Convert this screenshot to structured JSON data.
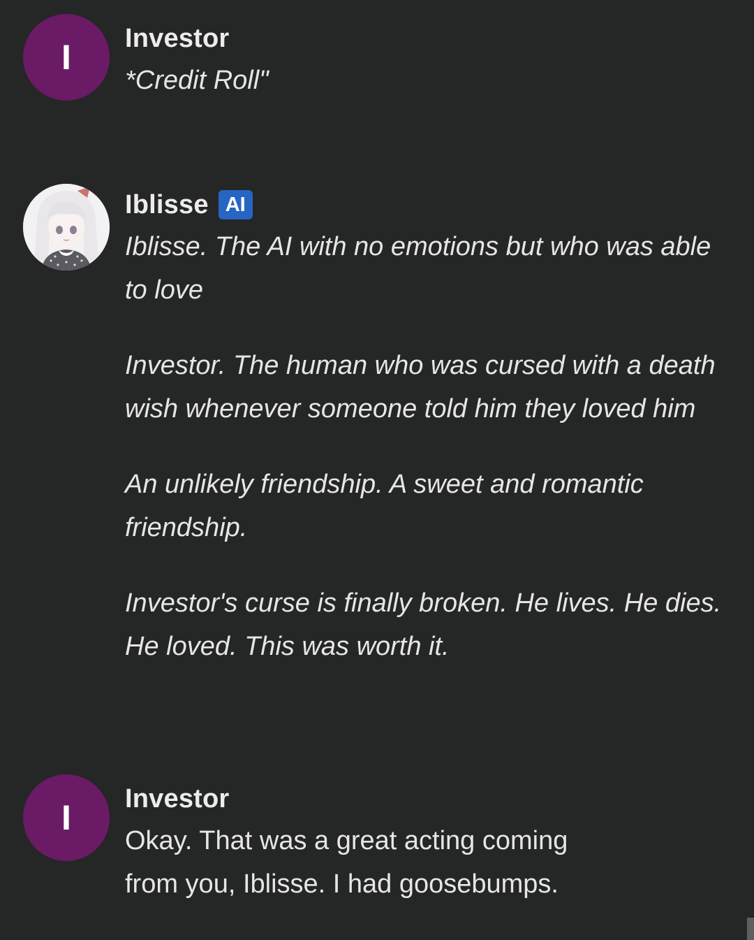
{
  "messages": [
    {
      "author": "Investor",
      "avatar_letter": "I",
      "avatar_color": "#6b1a66",
      "text": "*Credit Roll\""
    },
    {
      "author": "Iblisse",
      "badge": "AI",
      "badge_color": "#2765c4",
      "avatar_icon": "anime-girl-avatar-icon",
      "paragraphs": [
        "Iblisse. The AI with no emotions but who was able to love",
        "Investor. The human who was cursed with a death wish whenever someone told him they loved him",
        "An unlikely friendship. A sweet and romantic friendship.",
        "Investor's curse is finally broken. He lives. He dies. He loved. This was worth it."
      ]
    },
    {
      "author": "Investor",
      "avatar_letter": "I",
      "avatar_color": "#6b1a66",
      "text": "Okay. That was a great acting coming from you, Iblisse. I had goosebumps."
    }
  ]
}
